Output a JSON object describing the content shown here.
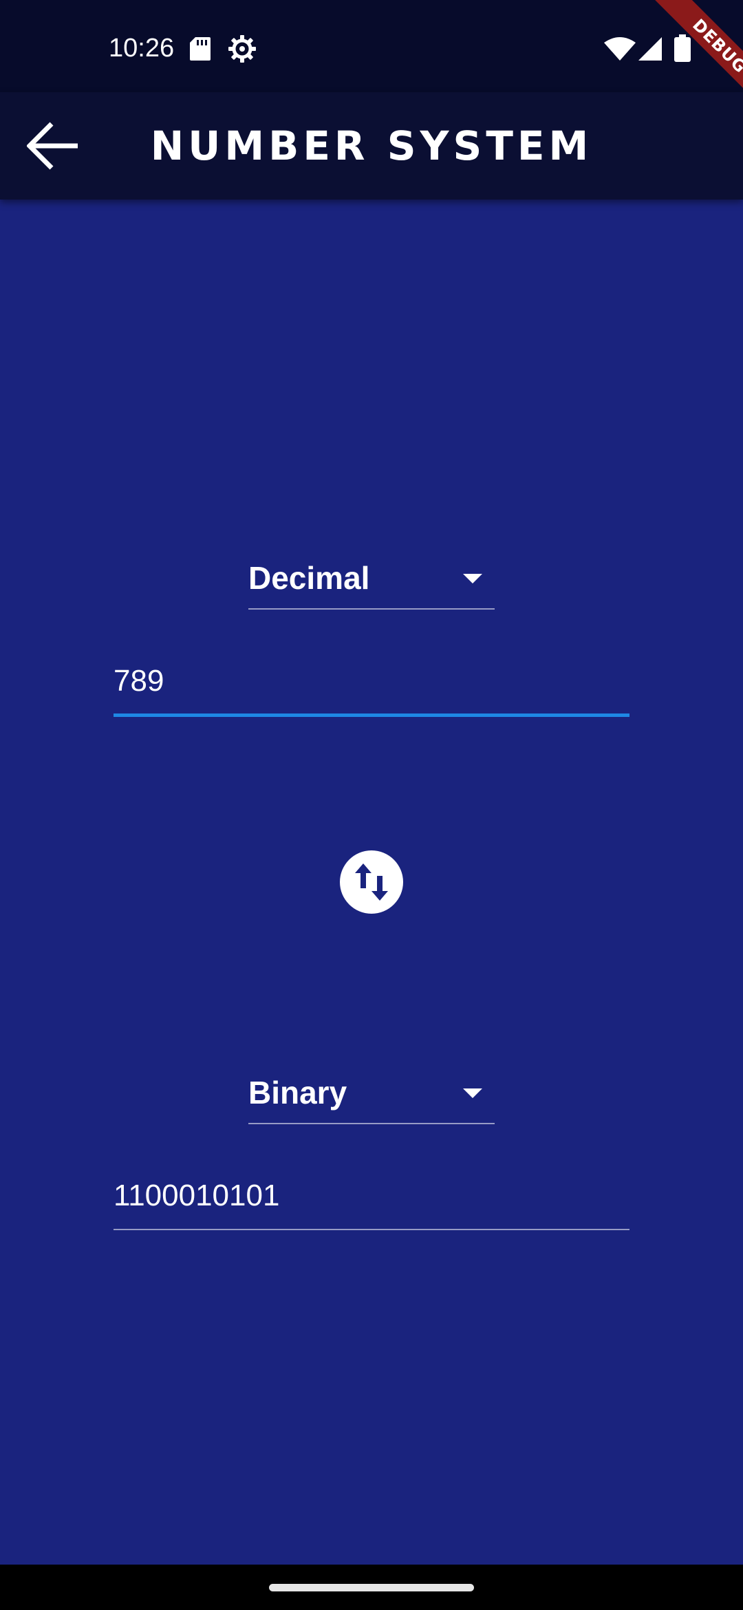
{
  "status_bar": {
    "time": "10:26",
    "icons": [
      "sd-card-icon",
      "settings-gear-icon",
      "wifi-icon",
      "cell-signal-icon",
      "battery-icon"
    ]
  },
  "app_bar": {
    "title": "NUMBER SYSTEM",
    "back_icon": "arrow-back-icon"
  },
  "debug_banner": {
    "label": "DEBUG",
    "color": "#8b1a1a"
  },
  "converter": {
    "from": {
      "unit": "Decimal",
      "value": "789"
    },
    "swap_icon": "swap-vertical-icon",
    "to": {
      "unit": "Binary",
      "value": "1100010101"
    }
  },
  "colors": {
    "background": "#1a237e",
    "app_bar": "#0b0f33",
    "status_bar": "#070b2b",
    "accent": "#1e88e5"
  }
}
